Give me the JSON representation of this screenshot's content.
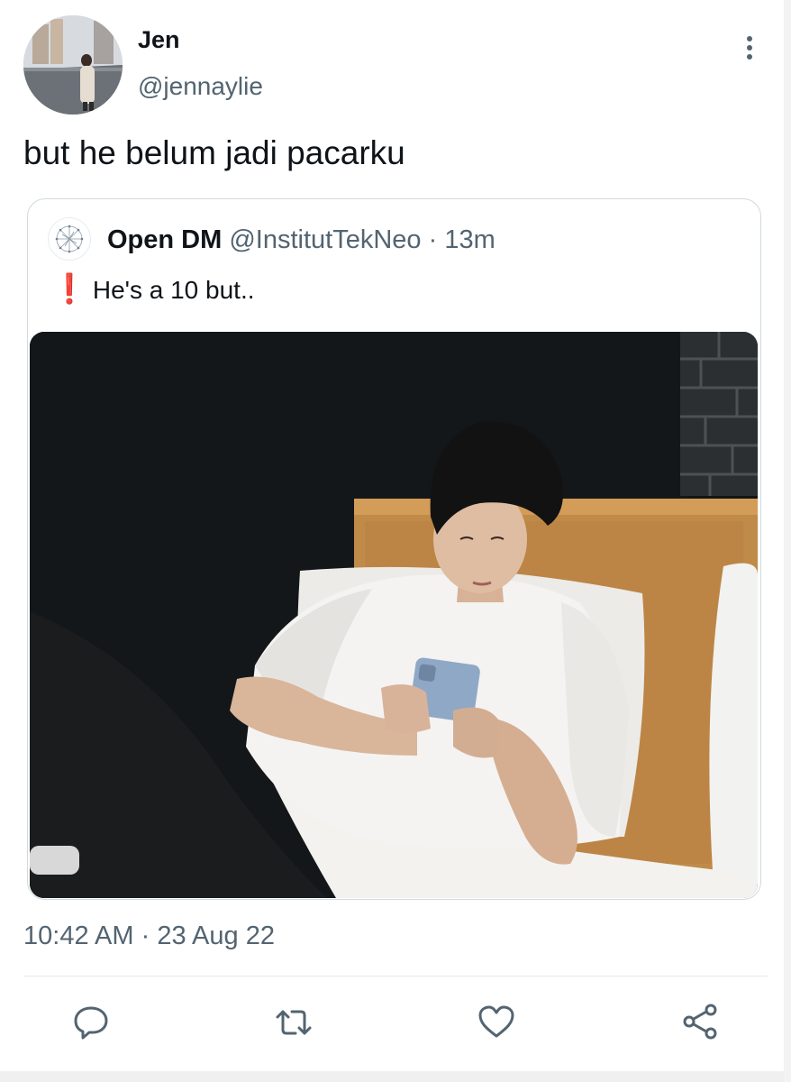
{
  "tweet": {
    "author_name": "Jen",
    "author_handle": "@jennaylie",
    "text": "but he belum jadi pacarku",
    "timestamp": "10:42 AM",
    "separator": "·",
    "date": "23 Aug 22"
  },
  "quoted_tweet": {
    "author_name": "Open DM",
    "author_handle": "@InstitutTekNeo",
    "separator": "·",
    "time_ago": "13m",
    "emoji": "❗",
    "text": "He's a 10 but.."
  },
  "actions": [
    {
      "name": "reply",
      "icon": "reply-icon"
    },
    {
      "name": "retweet",
      "icon": "retweet-icon"
    },
    {
      "name": "like",
      "icon": "heart-icon"
    },
    {
      "name": "share",
      "icon": "share-icon"
    }
  ],
  "colors": {
    "primary_text": "#0f1419",
    "secondary_text": "#536471",
    "border": "#cfd9de",
    "alert": "#e0245e"
  }
}
